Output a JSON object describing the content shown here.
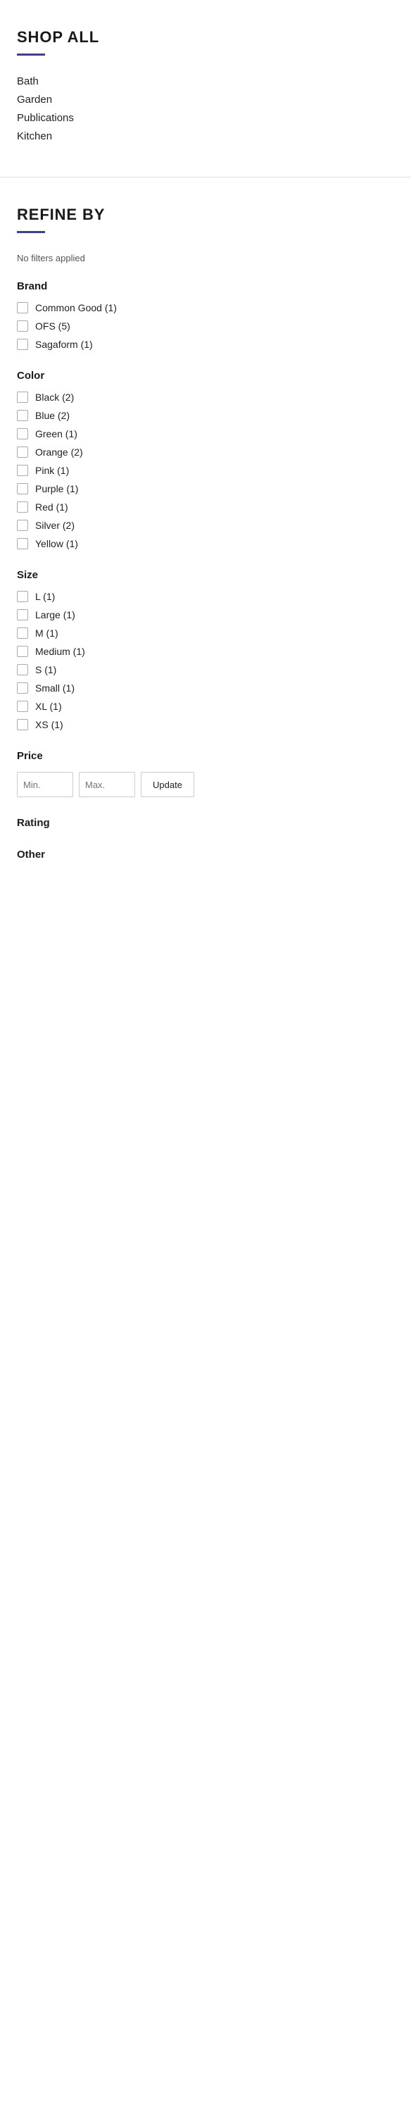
{
  "shopAll": {
    "title": "SHOP ALL",
    "navItems": [
      {
        "label": "Bath",
        "href": "#"
      },
      {
        "label": "Garden",
        "href": "#"
      },
      {
        "label": "Publications",
        "href": "#"
      },
      {
        "label": "Kitchen",
        "href": "#"
      }
    ]
  },
  "refineBy": {
    "title": "REFINE BY",
    "noFilters": "No filters applied",
    "brand": {
      "title": "Brand",
      "options": [
        {
          "label": "Common Good (1)",
          "value": "common-good"
        },
        {
          "label": "OFS (5)",
          "value": "ofs"
        },
        {
          "label": "Sagaform (1)",
          "value": "sagaform"
        }
      ]
    },
    "color": {
      "title": "Color",
      "options": [
        {
          "label": "Black (2)",
          "value": "black"
        },
        {
          "label": "Blue (2)",
          "value": "blue"
        },
        {
          "label": "Green (1)",
          "value": "green"
        },
        {
          "label": "Orange (2)",
          "value": "orange"
        },
        {
          "label": "Pink (1)",
          "value": "pink"
        },
        {
          "label": "Purple (1)",
          "value": "purple"
        },
        {
          "label": "Red (1)",
          "value": "red"
        },
        {
          "label": "Silver (2)",
          "value": "silver"
        },
        {
          "label": "Yellow (1)",
          "value": "yellow"
        }
      ]
    },
    "size": {
      "title": "Size",
      "options": [
        {
          "label": "L (1)",
          "value": "l"
        },
        {
          "label": "Large (1)",
          "value": "large"
        },
        {
          "label": "M (1)",
          "value": "m"
        },
        {
          "label": "Medium (1)",
          "value": "medium"
        },
        {
          "label": "S (1)",
          "value": "s"
        },
        {
          "label": "Small (1)",
          "value": "small"
        },
        {
          "label": "XL (1)",
          "value": "xl"
        },
        {
          "label": "XS (1)",
          "value": "xs"
        }
      ]
    },
    "price": {
      "title": "Price",
      "minPlaceholder": "Min.",
      "maxPlaceholder": "Max.",
      "updateLabel": "Update"
    },
    "rating": {
      "title": "Rating"
    },
    "other": {
      "title": "Other"
    }
  }
}
